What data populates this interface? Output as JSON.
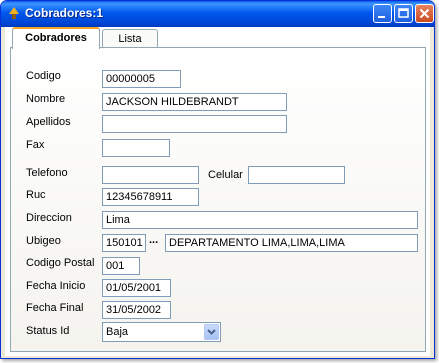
{
  "window": {
    "title": "Cobradores:1"
  },
  "tabs": [
    {
      "label": "Cobradores",
      "active": true
    },
    {
      "label": "Lista",
      "active": false
    }
  ],
  "form": {
    "codigo": {
      "label": "Codigo",
      "value": "00000005"
    },
    "nombre": {
      "label": "Nombre",
      "value": "JACKSON HILDEBRANDT"
    },
    "apellidos": {
      "label": "Apellidos",
      "value": ""
    },
    "fax": {
      "label": "Fax",
      "value": ""
    },
    "telefono": {
      "label": "Telefono",
      "value": ""
    },
    "celular": {
      "label": "Celular",
      "value": ""
    },
    "ruc": {
      "label": "Ruc",
      "value": "12345678911"
    },
    "direccion": {
      "label": "Direccion",
      "value": "Lima"
    },
    "ubigeo": {
      "label": "Ubigeo",
      "code": "150101",
      "lookup_label": "...",
      "description": "DEPARTAMENTO LIMA,LIMA,LIMA"
    },
    "codigo_postal": {
      "label": "Codigo Postal",
      "value": "001"
    },
    "fecha_inicio": {
      "label": "Fecha Inicio",
      "value": "01/05/2001"
    },
    "fecha_final": {
      "label": "Fecha Final",
      "value": "31/05/2002"
    },
    "status_id": {
      "label": "Status Id",
      "value": "Baja"
    }
  },
  "colors": {
    "titlebar": "#0058ee",
    "close_button": "#c94a21",
    "active_tab_accent": "#f5a623",
    "field_border": "#7f9db9"
  },
  "icons": {
    "app": "acorn-icon",
    "minimize": "minimize-icon",
    "maximize": "maximize-icon",
    "close": "close-icon",
    "dropdown": "chevron-down-icon"
  }
}
